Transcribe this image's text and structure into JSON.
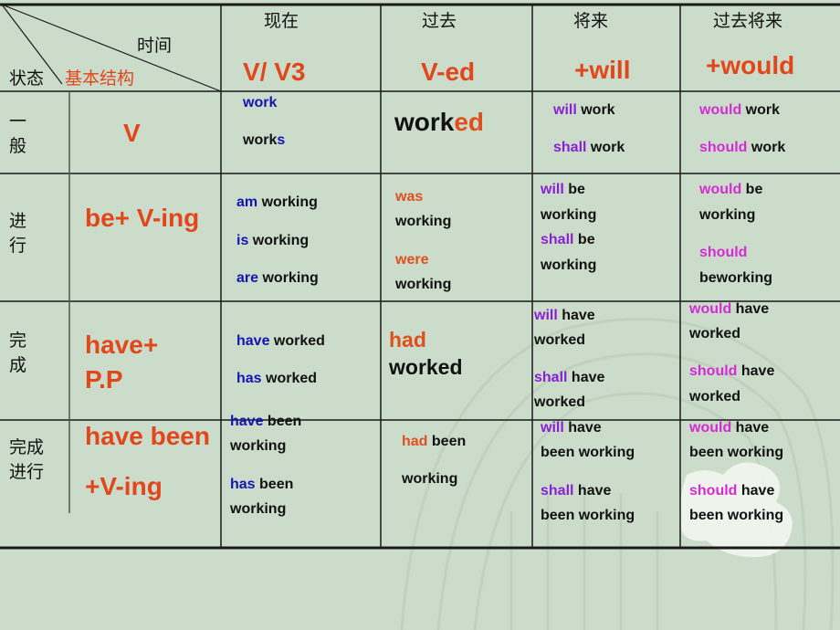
{
  "colors": {
    "background": "#cbdcca",
    "structure_red": "#e2471c",
    "present_blue": "#1414b4",
    "past_orange": "#e0501e",
    "future_purple": "#8a1fd6",
    "future_past_magenta": "#d62ad6",
    "text_black": "#111111"
  },
  "corner": {
    "time_label": "时间",
    "state_label": "状态",
    "structure_label": "基本结构"
  },
  "columns": [
    {
      "title": "现在",
      "form": "V/ V3"
    },
    {
      "title": "过去",
      "form": "V-ed"
    },
    {
      "title": "将来",
      "form": "+will"
    },
    {
      "title": "过去将来",
      "form": "+would"
    }
  ],
  "rows": [
    {
      "state": "一般",
      "structure": [
        "V"
      ],
      "present": [
        [
          {
            "t": "work",
            "c": "blue"
          }
        ],
        [
          {
            "t": "work",
            "c": "black"
          },
          {
            "t": "s",
            "c": "blue"
          }
        ]
      ],
      "past": [
        [
          {
            "t": "work",
            "c": "black"
          },
          {
            "t": "ed",
            "c": "orange"
          }
        ]
      ],
      "future": [
        [
          {
            "t": "will",
            "c": "purple"
          },
          {
            "t": " work",
            "c": "black"
          }
        ],
        [
          {
            "t": "shall",
            "c": "purple"
          },
          {
            "t": " work",
            "c": "black"
          }
        ]
      ],
      "future_past": [
        [
          {
            "t": "would",
            "c": "magenta"
          },
          {
            "t": " work",
            "c": "black"
          }
        ],
        [
          {
            "t": "should",
            "c": "magenta"
          },
          {
            "t": " work",
            "c": "black"
          }
        ]
      ]
    },
    {
      "state": "进行",
      "structure": [
        "be+ V-ing"
      ],
      "present": [
        [
          {
            "t": "am",
            "c": "blue"
          },
          {
            "t": " working",
            "c": "black"
          }
        ],
        [
          {
            "t": "is",
            "c": "blue"
          },
          {
            "t": " working",
            "c": "black"
          }
        ],
        [
          {
            "t": "are",
            "c": "blue"
          },
          {
            "t": " working",
            "c": "black"
          }
        ]
      ],
      "past": [
        [
          {
            "t": "was",
            "c": "orange"
          }
        ],
        [
          {
            "t": "working",
            "c": "black"
          }
        ],
        [
          {
            "t": "were",
            "c": "orange"
          }
        ],
        [
          {
            "t": "working",
            "c": "black"
          }
        ]
      ],
      "future": [
        [
          {
            "t": "will",
            "c": "purple"
          },
          {
            "t": " be",
            "c": "black"
          }
        ],
        [
          {
            "t": "working",
            "c": "black"
          }
        ],
        [
          {
            "t": "shall",
            "c": "purple"
          },
          {
            "t": " be",
            "c": "black"
          }
        ],
        [
          {
            "t": "working",
            "c": "black"
          }
        ]
      ],
      "future_past": [
        [
          {
            "t": "would",
            "c": "magenta"
          },
          {
            "t": " be",
            "c": "black"
          }
        ],
        [
          {
            "t": "working",
            "c": "black"
          }
        ],
        [
          {
            "t": "should",
            "c": "magenta"
          }
        ],
        [
          {
            "t": "beworking",
            "c": "black"
          }
        ]
      ]
    },
    {
      "state": "完成",
      "structure": [
        "have+",
        "P.P"
      ],
      "present": [
        [
          {
            "t": "have",
            "c": "blue"
          },
          {
            "t": " worked",
            "c": "black"
          }
        ],
        [
          {
            "t": "has",
            "c": "blue"
          },
          {
            "t": " worked",
            "c": "black"
          }
        ]
      ],
      "past": [
        [
          {
            "t": "had",
            "c": "orange"
          }
        ],
        [
          {
            "t": "worked",
            "c": "black"
          }
        ]
      ],
      "future": [
        [
          {
            "t": "will",
            "c": "purple"
          },
          {
            "t": " have",
            "c": "black"
          }
        ],
        [
          {
            "t": "worked",
            "c": "black"
          }
        ],
        [
          {
            "t": "shall",
            "c": "purple"
          },
          {
            "t": " have",
            "c": "black"
          }
        ],
        [
          {
            "t": "worked",
            "c": "black"
          }
        ]
      ],
      "future_past": [
        [
          {
            "t": "would",
            "c": "magenta"
          },
          {
            "t": " have",
            "c": "black"
          }
        ],
        [
          {
            "t": "worked",
            "c": "black"
          }
        ],
        [
          {
            "t": "should",
            "c": "magenta"
          },
          {
            "t": " have",
            "c": "black"
          }
        ],
        [
          {
            "t": "worked",
            "c": "black"
          }
        ]
      ]
    },
    {
      "state": "完成进行",
      "structure": [
        "have been",
        "+V-ing"
      ],
      "present": [
        [
          {
            "t": "have",
            "c": "blue"
          },
          {
            "t": " been",
            "c": "black"
          }
        ],
        [
          {
            "t": "working",
            "c": "black"
          }
        ],
        [
          {
            "t": "has",
            "c": "blue"
          },
          {
            "t": " been",
            "c": "black"
          }
        ],
        [
          {
            "t": "working",
            "c": "black"
          }
        ]
      ],
      "past": [
        [
          {
            "t": "had",
            "c": "orange"
          },
          {
            "t": " been",
            "c": "black"
          }
        ],
        [
          {
            "t": "working",
            "c": "black"
          }
        ]
      ],
      "future": [
        [
          {
            "t": "will",
            "c": "purple"
          },
          {
            "t": " have",
            "c": "black"
          }
        ],
        [
          {
            "t": "been working",
            "c": "black"
          }
        ],
        [
          {
            "t": "shall",
            "c": "purple"
          },
          {
            "t": " have",
            "c": "black"
          }
        ],
        [
          {
            "t": "been working",
            "c": "black"
          }
        ]
      ],
      "future_past": [
        [
          {
            "t": "would",
            "c": "magenta"
          },
          {
            "t": " have",
            "c": "black"
          }
        ],
        [
          {
            "t": "been working",
            "c": "black"
          }
        ],
        [
          {
            "t": "should",
            "c": "magenta"
          },
          {
            "t": " have",
            "c": "black"
          }
        ],
        [
          {
            "t": "been working",
            "c": "black"
          }
        ]
      ]
    }
  ]
}
